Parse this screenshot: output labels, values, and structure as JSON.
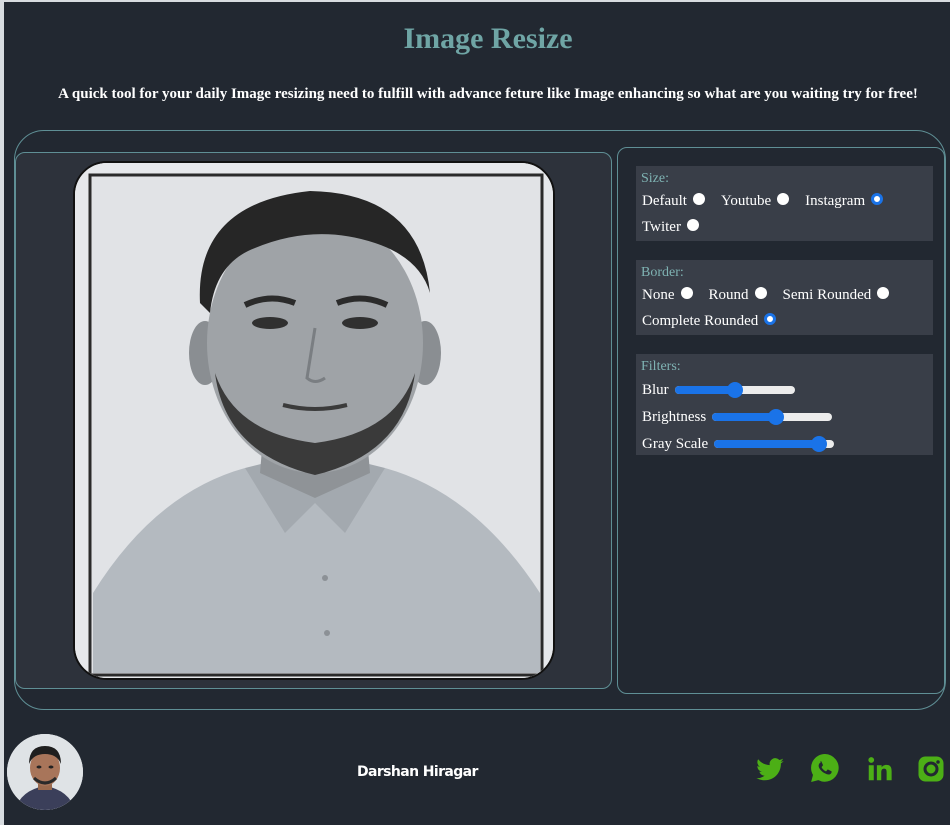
{
  "header": {
    "title": "Image Resize",
    "subtitle": "A quick tool for your daily Image resizing need to fulfill with advance feture like Image enhancing so what are you waiting try for free!"
  },
  "controls": {
    "size": {
      "label": "Size:",
      "options": [
        "Default",
        "Youtube",
        "Instagram",
        "Twiter"
      ],
      "selected": "Instagram"
    },
    "border": {
      "label": "Border:",
      "options": [
        "None",
        "Round",
        "Semi Rounded",
        "Complete Rounded"
      ],
      "selected": "Complete Rounded"
    },
    "filters": {
      "label": "Filters:",
      "sliders": [
        {
          "label": "Blur",
          "value": 0.5
        },
        {
          "label": "Brightness",
          "value": 0.53
        },
        {
          "label": "Gray Scale",
          "value": 0.87
        }
      ]
    }
  },
  "footer": {
    "author": "Darshan Hiragar",
    "social_icons": [
      "twitter-icon",
      "whatsapp-icon",
      "linkedin-icon",
      "instagram-icon"
    ],
    "social_color": "#4caf16"
  },
  "colors": {
    "background": "#222831",
    "accent": "#6fa5a5",
    "panel": "#393e48",
    "slider": "#1a73e8"
  }
}
